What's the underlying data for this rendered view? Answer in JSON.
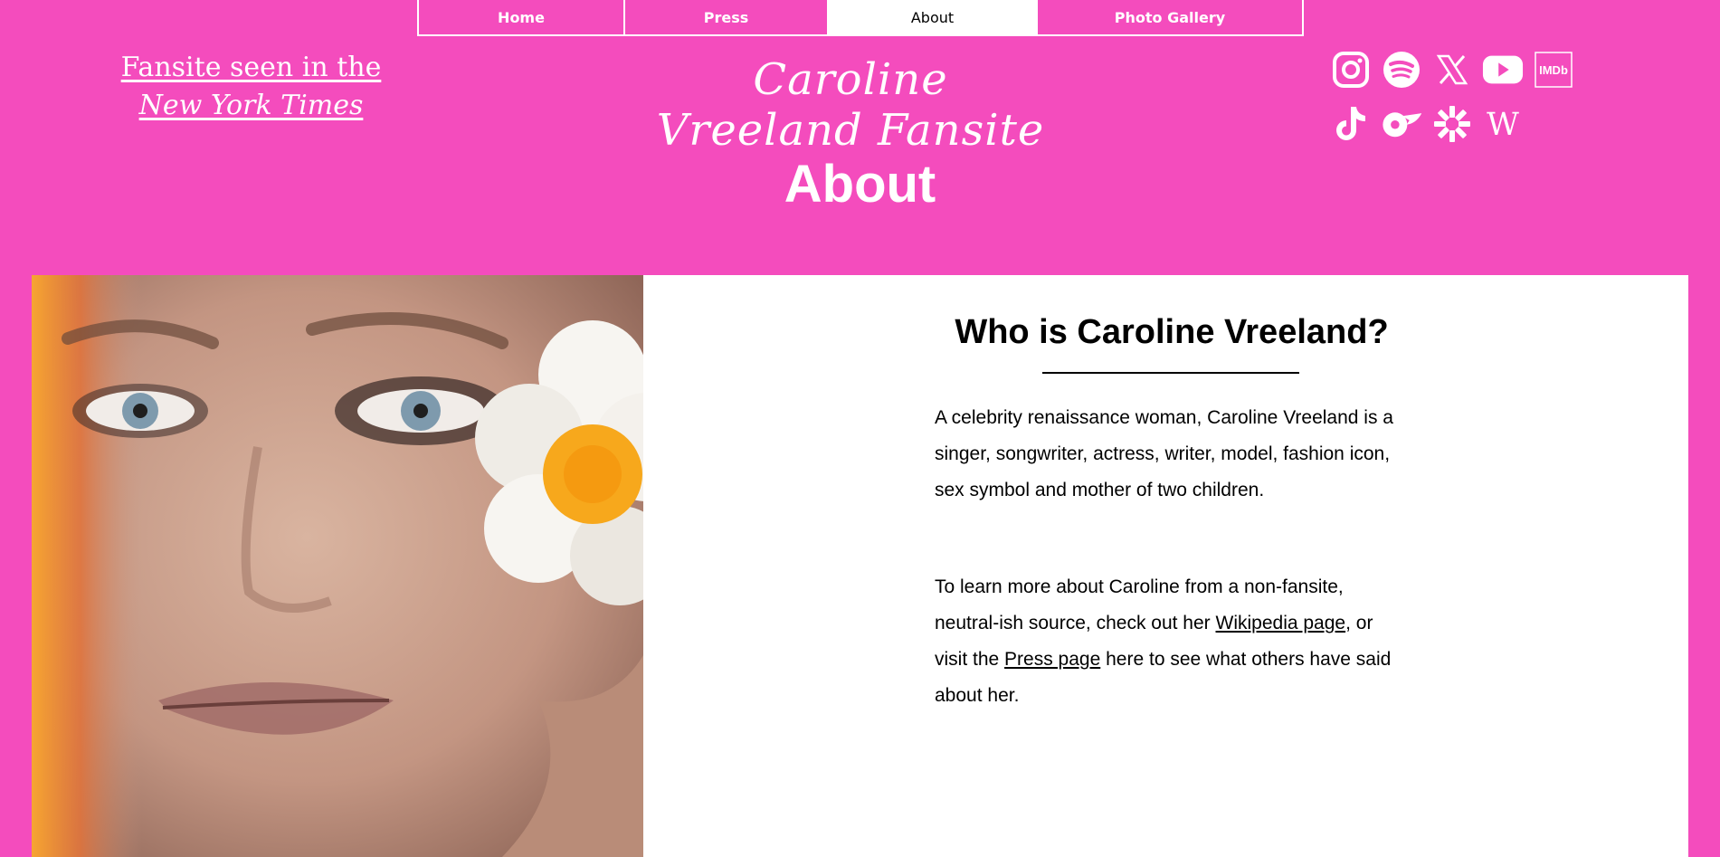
{
  "nav": {
    "items": [
      {
        "label": "Home"
      },
      {
        "label": "Press"
      },
      {
        "label": "About"
      },
      {
        "label": "Photo Gallery"
      }
    ],
    "active": "About"
  },
  "header": {
    "nyt_line1": "Fansite seen in the",
    "nyt_line2": "New York Times",
    "logo_text": "Caroline Vreeland Fansite"
  },
  "socials": {
    "icons": [
      "instagram-icon",
      "spotify-icon",
      "x-icon",
      "youtube-icon",
      "imdb-icon",
      "tiktok-icon",
      "onlyfans-icon",
      "linktree-icon",
      "wikipedia-icon"
    ],
    "imdb_text": "IMDb",
    "wiki_text": "W"
  },
  "page": {
    "heading": "About"
  },
  "about": {
    "title": "Who is Caroline Vreeland?",
    "intro": "A celebrity renaissance woman, Caroline Vreeland is a singer, songwriter, actress, writer, model, fashion icon, sex symbol and mother of two children.",
    "learn_before_wiki": "To learn more about Caroline from a non-fansite, neutral-ish source, check out her",
    "wiki_link": "Wikipedia page",
    "between_links": ", or visit the",
    "press_link": "Press page",
    "after_press": "here to see what others have said about her."
  },
  "colors": {
    "brand_pink": "#f44cbd",
    "white": "#ffffff",
    "text": "#000000"
  }
}
